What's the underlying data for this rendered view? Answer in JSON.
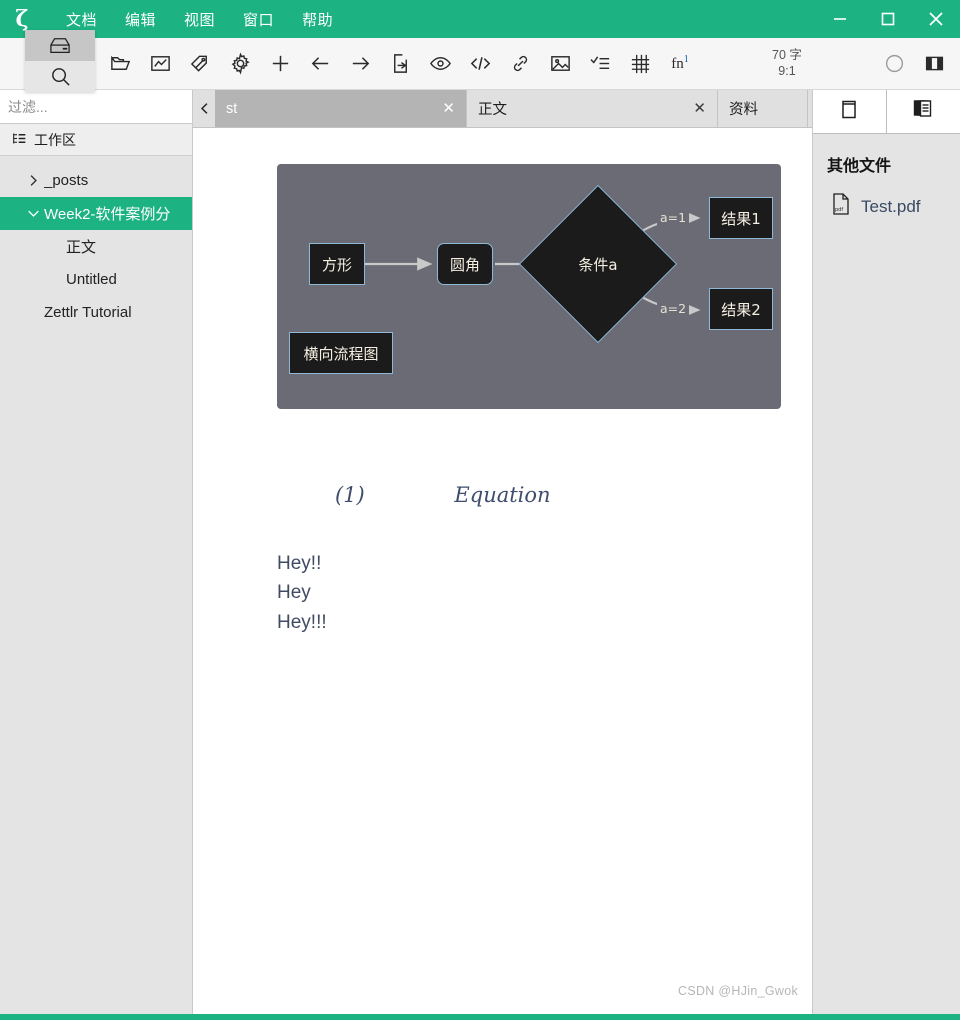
{
  "window": {
    "accent_color": "#1cb281",
    "app_logo": "ζ",
    "controls": {
      "minimize": "minimize-icon",
      "maximize": "maximize-icon",
      "close": "close-icon"
    }
  },
  "menubar": {
    "items": [
      {
        "label": "文档",
        "name": "menu-document"
      },
      {
        "label": "编辑",
        "name": "menu-edit"
      },
      {
        "label": "视图",
        "name": "menu-view"
      },
      {
        "label": "窗口",
        "name": "menu-window"
      },
      {
        "label": "帮助",
        "name": "menu-help"
      }
    ]
  },
  "mode_popup": {
    "options": [
      {
        "icon": "file-manager-icon",
        "active": true
      },
      {
        "icon": "search-icon",
        "active": false
      }
    ]
  },
  "toolbar": {
    "buttons": [
      {
        "icon": "open-folder-icon",
        "name": "open-workspace-button"
      },
      {
        "icon": "stats-chart-icon",
        "name": "statistics-button"
      },
      {
        "icon": "tag-icon",
        "name": "tag-cloud-button"
      },
      {
        "icon": "gear-icon",
        "name": "preferences-button"
      },
      {
        "icon": "plus-icon",
        "name": "new-file-button"
      },
      {
        "icon": "arrow-left-icon",
        "name": "back-button"
      },
      {
        "icon": "arrow-right-icon",
        "name": "forward-button"
      },
      {
        "icon": "export-file-icon",
        "name": "export-button"
      },
      {
        "icon": "eye-icon",
        "name": "preview-toggle-button"
      },
      {
        "icon": "code-icon",
        "name": "code-block-button"
      },
      {
        "icon": "link-icon",
        "name": "insert-link-button"
      },
      {
        "icon": "image-icon",
        "name": "insert-image-button"
      },
      {
        "icon": "task-list-icon",
        "name": "insert-task-list-button"
      },
      {
        "icon": "table-icon",
        "name": "insert-table-button"
      },
      {
        "icon": "footnote-icon",
        "name": "insert-footnote-button",
        "label": "fn",
        "sup": "1"
      }
    ],
    "wordcount": {
      "words": "70 字",
      "ratio": "9:1"
    },
    "right_buttons": [
      {
        "icon": "circle-icon",
        "name": "pomodoro-button"
      },
      {
        "icon": "split-panel-icon",
        "name": "toggle-sidebar-button"
      }
    ]
  },
  "sidebar": {
    "filter": {
      "value": "",
      "placeholder": "过滤..."
    },
    "workspace_header": {
      "label": "工作区",
      "icon": "tree-view-icon"
    },
    "tree": [
      {
        "label": "_posts",
        "depth": 0,
        "arrow": "chevron-right-icon",
        "selected": false,
        "name": "tree-item-posts"
      },
      {
        "label": "Week2-软件案例分",
        "depth": 0,
        "arrow": "chevron-down-icon",
        "selected": true,
        "name": "tree-item-week2"
      },
      {
        "label": "正文",
        "depth": 1,
        "arrow": "",
        "selected": false,
        "name": "tree-item-zhengwen"
      },
      {
        "label": "Untitled",
        "depth": 1,
        "arrow": "",
        "selected": false,
        "name": "tree-item-untitled"
      },
      {
        "label": "Zettlr Tutorial",
        "depth": 2,
        "arrow": "",
        "selected": false,
        "name": "tree-item-zettlr-tutorial"
      }
    ]
  },
  "tabbar": {
    "prev_icon": "chevron-left-icon",
    "next_icon": "chevron-right-icon",
    "tabs": [
      {
        "title": "st",
        "active": true,
        "closable": true,
        "close_label": "✕",
        "name": "editor-tab-st"
      },
      {
        "title": "正文",
        "active": false,
        "closable": true,
        "close_label": "✕",
        "name": "editor-tab-zhengwen"
      },
      {
        "title": "资料",
        "active": false,
        "closable": false,
        "close_label": "",
        "name": "editor-tab-ziliao"
      }
    ]
  },
  "document": {
    "diagram": {
      "type": "flowchart",
      "caption": "横向流程图",
      "background": "#6b6b75",
      "node_fill": "#1b1b1b",
      "node_border": "#8fb8d8",
      "node_text_color": "#f5efe2",
      "nodes": [
        {
          "id": "n1",
          "label": "方形",
          "shape": "rect"
        },
        {
          "id": "n2",
          "label": "圆角",
          "shape": "rounded"
        },
        {
          "id": "n3",
          "label": "条件a",
          "shape": "diamond"
        },
        {
          "id": "n4",
          "label": "结果1",
          "shape": "rect"
        },
        {
          "id": "n5",
          "label": "结果2",
          "shape": "rect"
        },
        {
          "id": "n6",
          "label": "横向流程图",
          "shape": "rect"
        }
      ],
      "edges": [
        {
          "from": "n1",
          "to": "n2",
          "label": ""
        },
        {
          "from": "n2",
          "to": "n3",
          "label": ""
        },
        {
          "from": "n3",
          "to": "n4",
          "label": "a=1"
        },
        {
          "from": "n3",
          "to": "n5",
          "label": "a=2"
        }
      ]
    },
    "equation": {
      "text": "Equation",
      "number": "(1)"
    },
    "paragraph_lines": [
      "Hey!!",
      "Hey",
      "Hey!!!"
    ]
  },
  "rightpanel": {
    "tabs": [
      {
        "icon": "attachment-document-icon",
        "name": "panel-tab-attachments",
        "active": true
      },
      {
        "icon": "stacked-documents-icon",
        "name": "panel-tab-related-files",
        "active": false
      }
    ],
    "title": "其他文件",
    "files": [
      {
        "name": "Test.pdf",
        "icon": "pdf-file-icon"
      }
    ]
  },
  "watermark": "CSDN @HJin_Gwok"
}
